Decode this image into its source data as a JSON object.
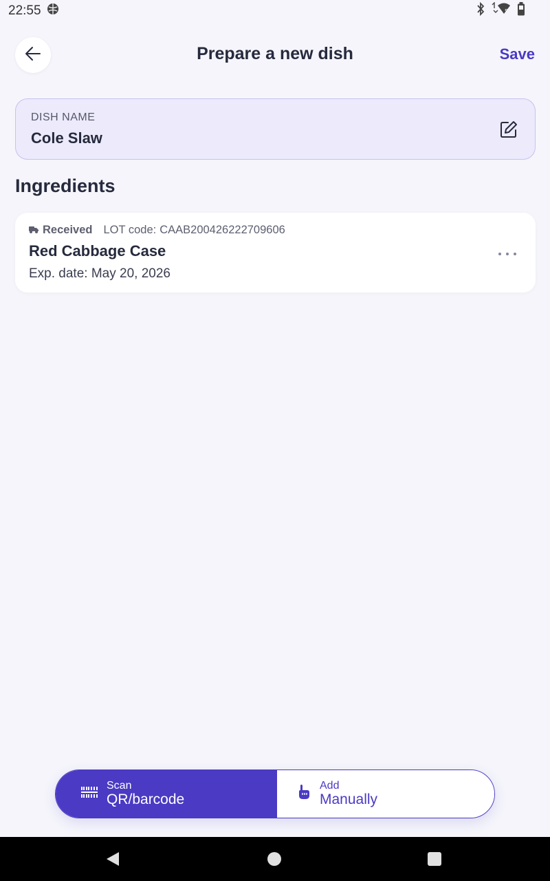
{
  "status_bar": {
    "time": "22:55",
    "icons": [
      "notification-icon",
      "bluetooth-icon",
      "wifi-icon",
      "battery-icon"
    ]
  },
  "header": {
    "title": "Prepare a new dish",
    "save_label": "Save"
  },
  "dish": {
    "label": "DISH NAME",
    "value": "Cole Slaw"
  },
  "ingredients": {
    "heading": "Ingredients",
    "items": [
      {
        "status": "Received",
        "lot_label": "LOT code:",
        "lot_code": "CAAB200426222709606",
        "name": "Red Cabbage Case",
        "exp": "Exp. date: May 20, 2026"
      }
    ]
  },
  "actions": {
    "scan_small": "Scan",
    "scan_large": "QR/barcode",
    "manual_small": "Add",
    "manual_large": "Manually"
  },
  "colors": {
    "accent": "#4a3ac4",
    "background": "#f5f5fb",
    "dish_card_bg": "#eceafb",
    "text_primary": "#262a3d"
  }
}
